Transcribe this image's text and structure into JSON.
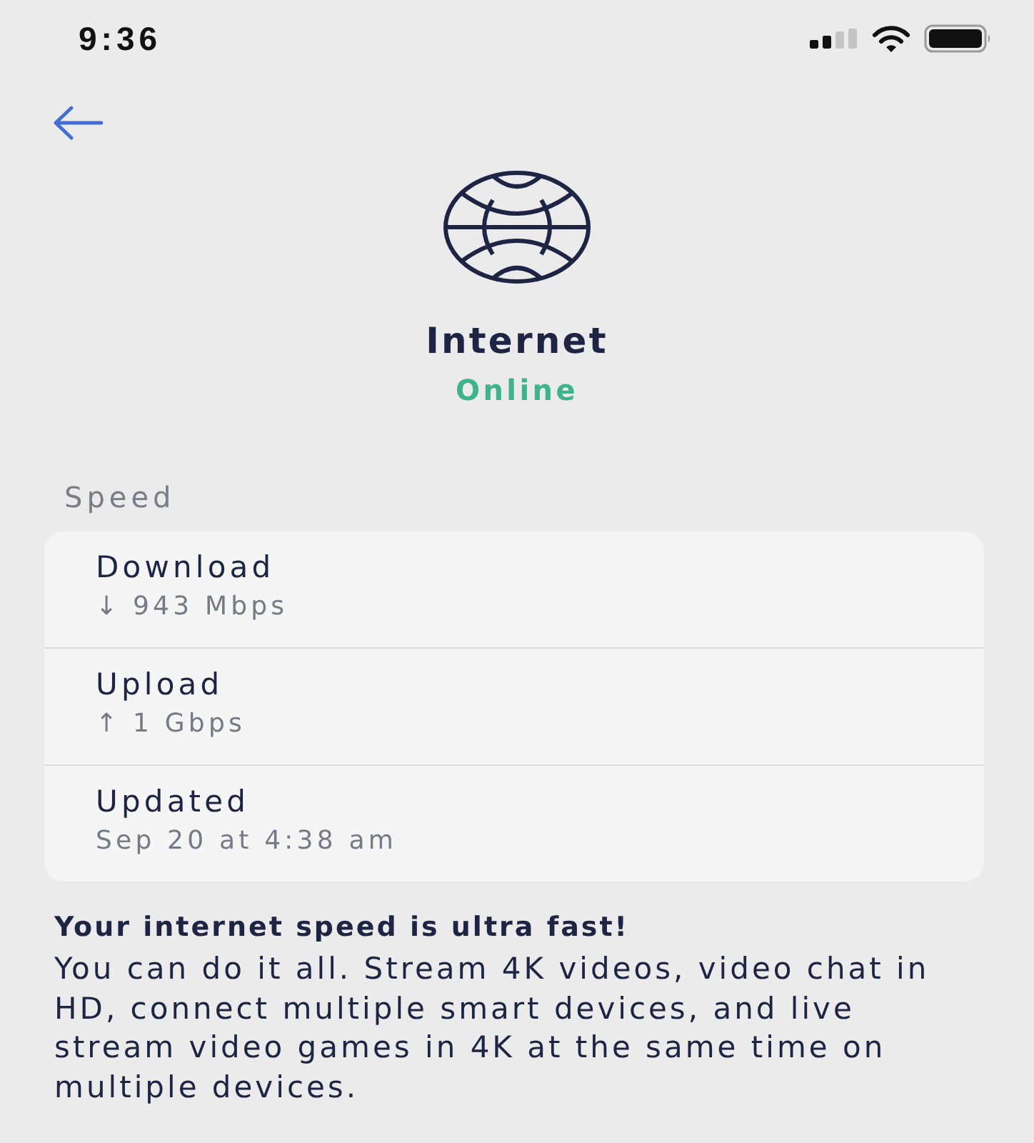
{
  "status_bar": {
    "time": "9:36"
  },
  "header": {
    "title": "Internet",
    "status": "Online"
  },
  "speed": {
    "label": "Speed",
    "rows": [
      {
        "label": "Download",
        "value": "↓ 943 Mbps"
      },
      {
        "label": "Upload",
        "value": "↑ 1 Gbps"
      },
      {
        "label": "Updated",
        "value": "Sep 20 at 4:38 am"
      }
    ]
  },
  "message": {
    "title": "Your internet speed is ultra fast!",
    "body": "You can do it all. Stream 4K videos, video chat in HD, connect multiple smart devices, and live stream video games in 4K at the same time on multiple devices."
  }
}
